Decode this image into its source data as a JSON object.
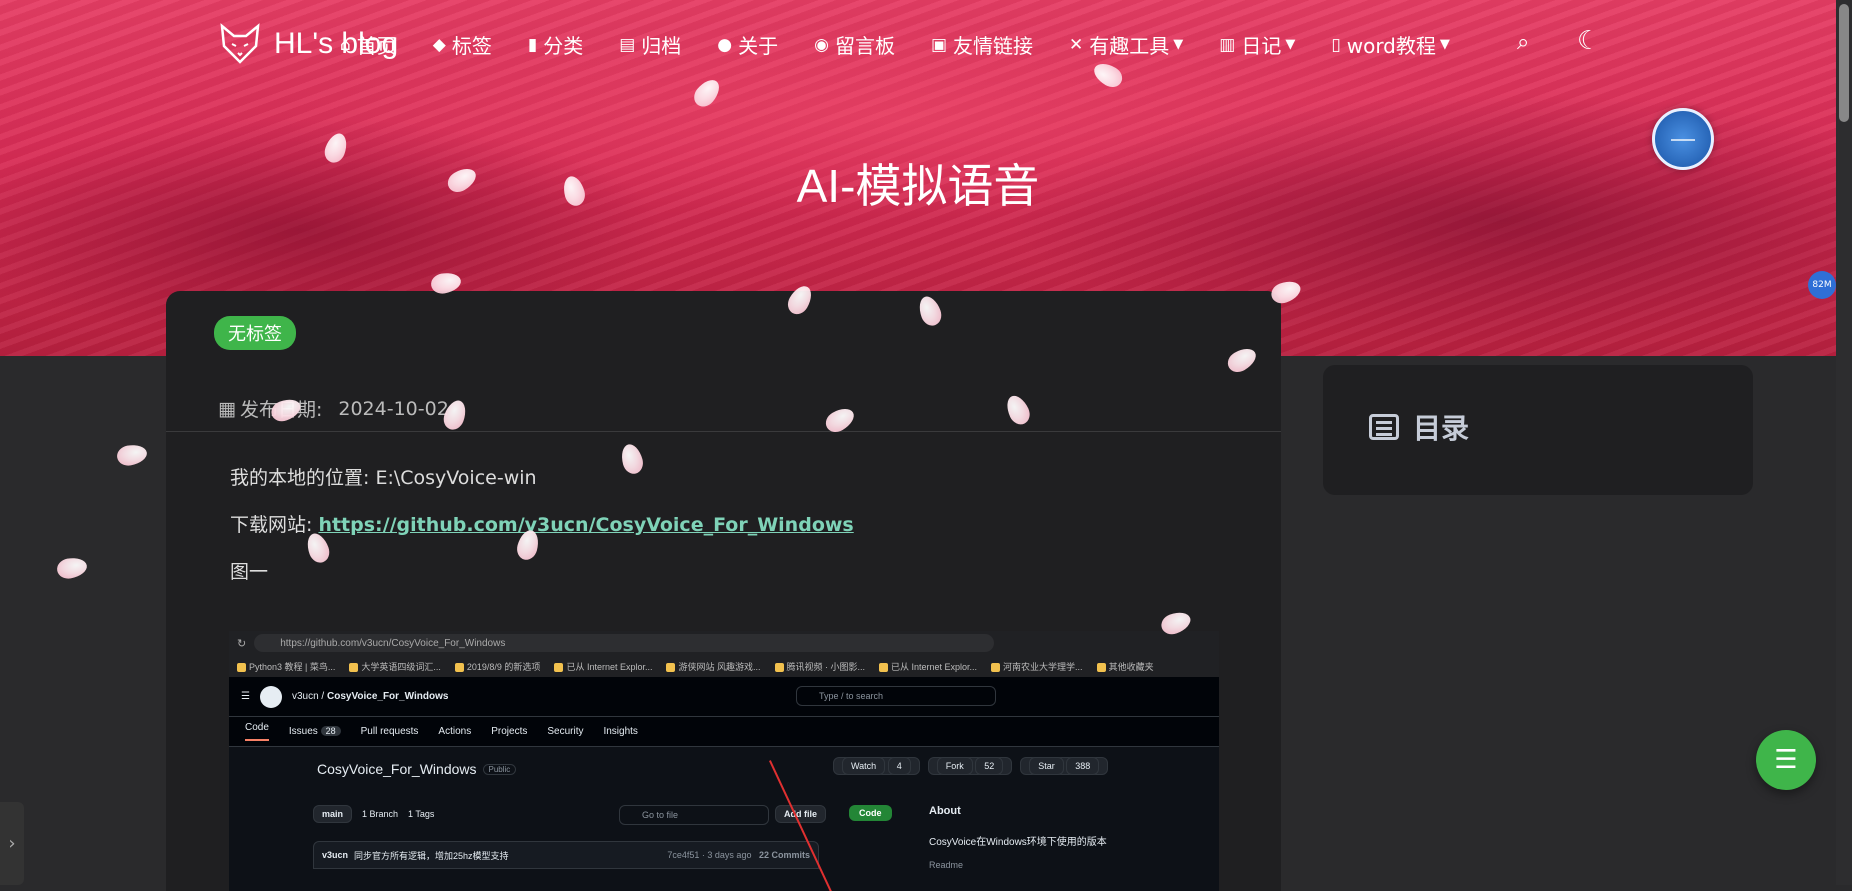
{
  "site": {
    "title": "HL's blog"
  },
  "nav": {
    "items": [
      {
        "label": "首页",
        "icon": "home-icon"
      },
      {
        "label": "标签",
        "icon": "tags-icon"
      },
      {
        "label": "分类",
        "icon": "bookmark-icon"
      },
      {
        "label": "归档",
        "icon": "archive-icon"
      },
      {
        "label": "关于",
        "icon": "user-circle-icon"
      },
      {
        "label": "留言板",
        "icon": "comments-icon"
      },
      {
        "label": "友情链接",
        "icon": "address-card-icon"
      },
      {
        "label": "有趣工具",
        "icon": "tools-icon"
      },
      {
        "label": "日记",
        "icon": "book-icon"
      },
      {
        "label": "word教程",
        "icon": "word-file-icon"
      }
    ]
  },
  "page": {
    "title": "AI-模拟语音"
  },
  "post": {
    "tag": "无标签",
    "date_label": "发布日期:",
    "date_value": "2024-10-02",
    "line1": "我的本地的位置: E:\\CosyVoice-win",
    "download_label": "下载网站: ",
    "download_link": "https://github.com/v3ucn/CosyVoice_For_Windows",
    "fig_label": "图一"
  },
  "screenshot": {
    "url": "https://github.com/v3ucn/CosyVoice_For_Windows",
    "bookmarks": [
      "Python3 教程 | 菜鸟...",
      "大学英语四级词汇...",
      "2019/8/9 的新选项",
      "已从 Internet Explor...",
      "游侠网站 风趣游戏...",
      "腾讯视频 · 小图影...",
      "已从 Internet Explor...",
      "河南农业大学理学...",
      "其他收藏夹"
    ],
    "owner": "v3ucn",
    "repo": "CosyVoice_For_Windows",
    "search_placeholder": "Type / to search",
    "tabs": [
      "Code",
      "Issues",
      "Pull requests",
      "Actions",
      "Projects",
      "Security",
      "Insights"
    ],
    "issues_count": "28",
    "public": "Public",
    "watch": "Watch",
    "watch_count": "4",
    "fork": "Fork",
    "fork_count": "52",
    "star": "Star",
    "star_count": "388",
    "branch": "main",
    "branches": "1 Branch",
    "tags": "1 Tags",
    "goto_placeholder": "Go to file",
    "add_file": "Add file",
    "code_btn": "Code",
    "commit_author": "v3ucn",
    "commit_msg": "同步官方所有逻辑，增加25hz模型支持",
    "commit_meta": "7ce4f51 · 3 days ago",
    "commits": "22 Commits",
    "about_title": "About",
    "about_desc": "CosyVoice在Windows环境下使用的版本",
    "readme": "Readme"
  },
  "toc": {
    "title": "目录"
  },
  "widgets": {
    "mem": "82M"
  },
  "colors": {
    "banner": "#d82c55",
    "accent": "#3fb54a",
    "link": "#7fd3b8",
    "card": "#1f1f21"
  }
}
